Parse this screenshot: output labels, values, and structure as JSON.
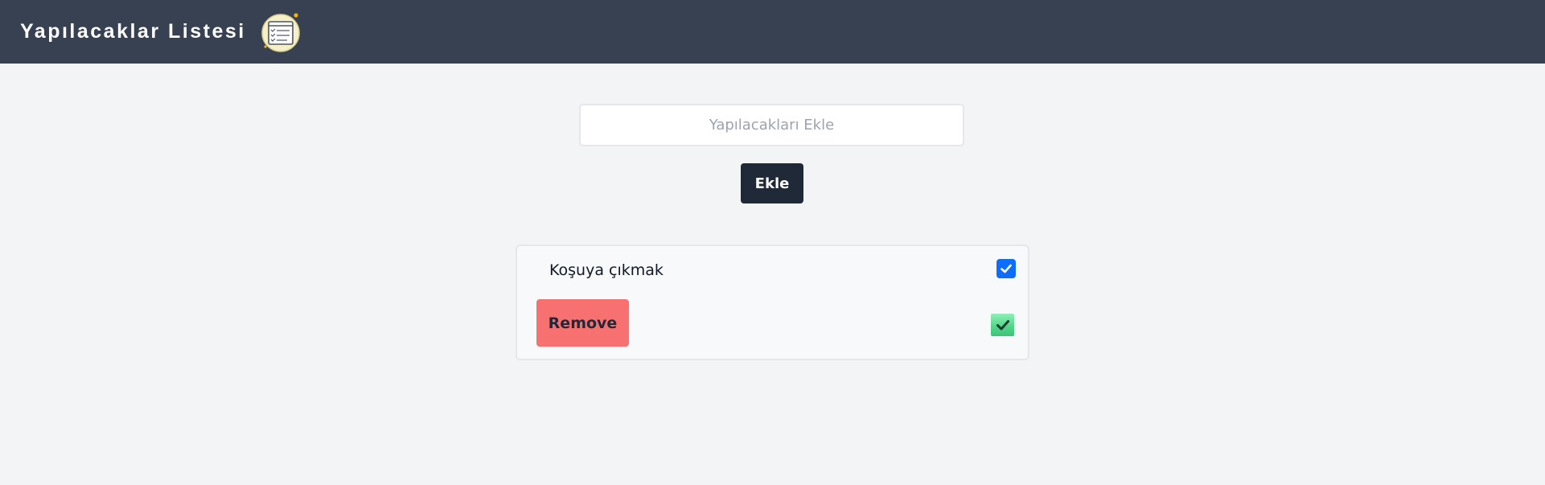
{
  "header": {
    "title": "Yapılacaklar Listesi",
    "logo_icon": "notepad-checklist-icon"
  },
  "form": {
    "input_placeholder": "Yapılacakları Ekle",
    "input_value": "",
    "add_label": "Ekle"
  },
  "todos": [
    {
      "text": "Koşuya çıkmak",
      "checked": true,
      "remove_label": "Remove",
      "done_icon": "checkmark-icon"
    }
  ],
  "colors": {
    "navbar": "#374151",
    "background": "#f3f4f6",
    "add_button": "#1f2937",
    "remove_button": "#f87171",
    "checkbox": "#0d6efd",
    "done_icon": "#4fd487"
  }
}
